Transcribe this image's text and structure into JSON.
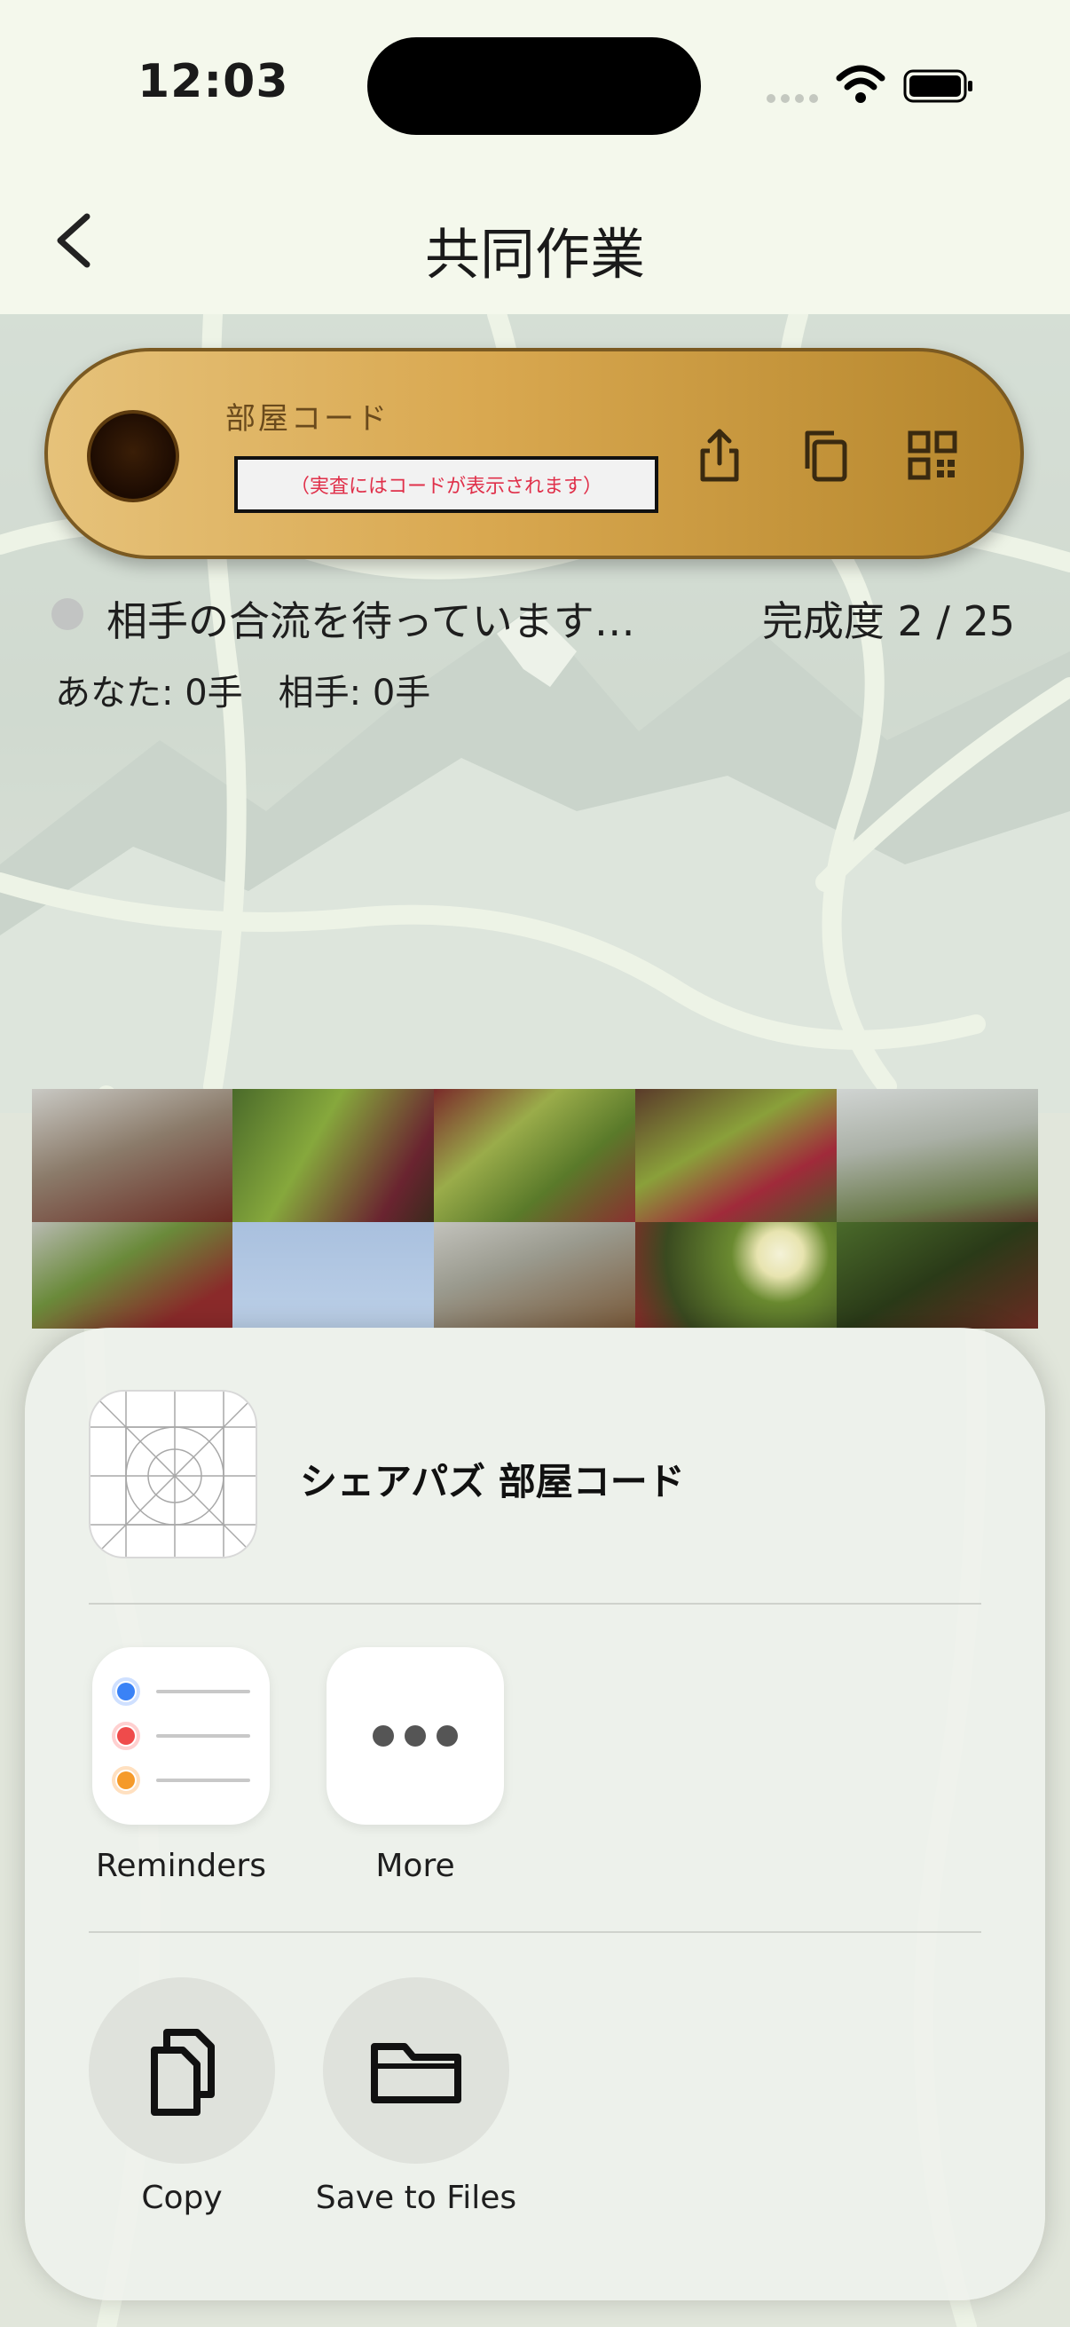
{
  "status_bar": {
    "time": "12:03"
  },
  "nav": {
    "title": "共同作業"
  },
  "room": {
    "label": "部屋コード",
    "code_placeholder": "（実査にはコードが表示されます）"
  },
  "status": {
    "waiting": "相手の合流を待っています…",
    "progress": "完成度 2 / 25",
    "moves": "あなた: 0手　相手: 0手"
  },
  "share_sheet": {
    "title": "シェアパズ 部屋コード",
    "apps": [
      {
        "label": "Reminders",
        "icon": "reminders-icon"
      },
      {
        "label": "More",
        "icon": "more-icon"
      }
    ],
    "actions": [
      {
        "label": "Copy",
        "icon": "copy-icon"
      },
      {
        "label": "Save to Files",
        "icon": "folder-icon"
      }
    ]
  },
  "colors": {
    "pill_gold": "#d9a850",
    "code_text": "#e0304a",
    "background": "#f4f8ec"
  }
}
